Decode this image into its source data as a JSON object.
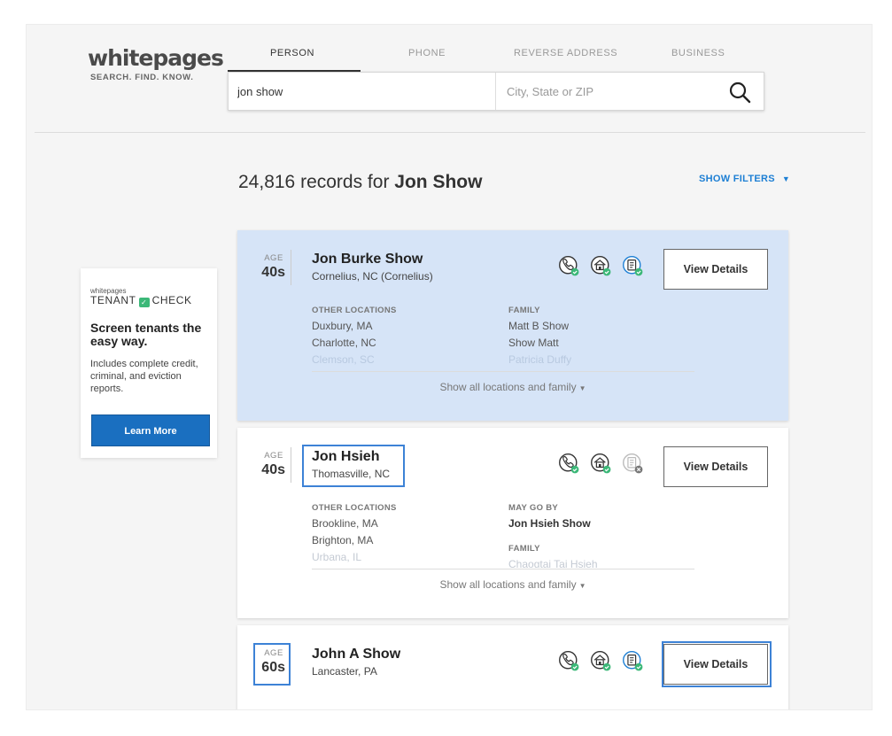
{
  "header": {
    "logo_word": "whitepages",
    "logo_tagline": "SEARCH. FIND. KNOW.",
    "tabs": [
      {
        "label": "PERSON",
        "active": true
      },
      {
        "label": "PHONE",
        "active": false
      },
      {
        "label": "REVERSE ADDRESS",
        "active": false
      },
      {
        "label": "BUSINESS",
        "active": false
      }
    ],
    "search": {
      "name_value": "jon show",
      "location_value": "",
      "location_placeholder": "City, State or ZIP",
      "search_icon": "magnifier-icon"
    }
  },
  "results": {
    "count": "24,816",
    "records_text": "records for",
    "query": "Jon Show",
    "filters_label": "SHOW FILTERS"
  },
  "ad": {
    "brand": "whitepages",
    "product_a": "TENANT",
    "product_b": "CHECK",
    "headline": "Screen tenants the easy way.",
    "body": "Includes complete credit, criminal, and eviction reports.",
    "button": "Learn More"
  },
  "cards": [
    {
      "age_label": "AGE",
      "age": "40s",
      "name": "Jon Burke Show",
      "location": "Cornelius, NC (Cornelius)",
      "icons": [
        "phone-verified-icon",
        "address-verified-icon",
        "records-verified-icon"
      ],
      "view_details": "View Details",
      "left_label": "OTHER LOCATIONS",
      "left_items": [
        "Duxbury, MA",
        "Charlotte, NC",
        "Clemson, SC"
      ],
      "right_label": "FAMILY",
      "right_items": [
        "Matt B Show",
        "Show Matt",
        "Patricia Duffy"
      ],
      "show_all": "Show all locations and family"
    },
    {
      "age_label": "AGE",
      "age": "40s",
      "name": "Jon Hsieh",
      "location": "Thomasville, NC",
      "icons": [
        "phone-verified-icon",
        "address-verified-icon",
        "records-unavailable-icon"
      ],
      "view_details": "View Details",
      "left_label": "OTHER LOCATIONS",
      "left_items": [
        "Brookline, MA",
        "Brighton, MA",
        "Urbana, IL"
      ],
      "right_label": "MAY GO BY",
      "right_items": [
        "Jon Hsieh Show"
      ],
      "right_label2": "FAMILY",
      "right_items2": [
        "Chaogtai Tai Hsieh"
      ],
      "show_all": "Show all locations and family"
    },
    {
      "age_label": "AGE",
      "age": "60s",
      "name": "John A Show",
      "location": "Lancaster, PA",
      "icons": [
        "phone-verified-icon",
        "address-verified-icon",
        "records-verified-icon"
      ],
      "view_details": "View Details"
    }
  ],
  "colors": {
    "accent_blue": "#1d7fd4",
    "highlight_card": "#d6e4f7",
    "verified_green": "#3cb878",
    "annotation_outline": "#3d82d6"
  }
}
